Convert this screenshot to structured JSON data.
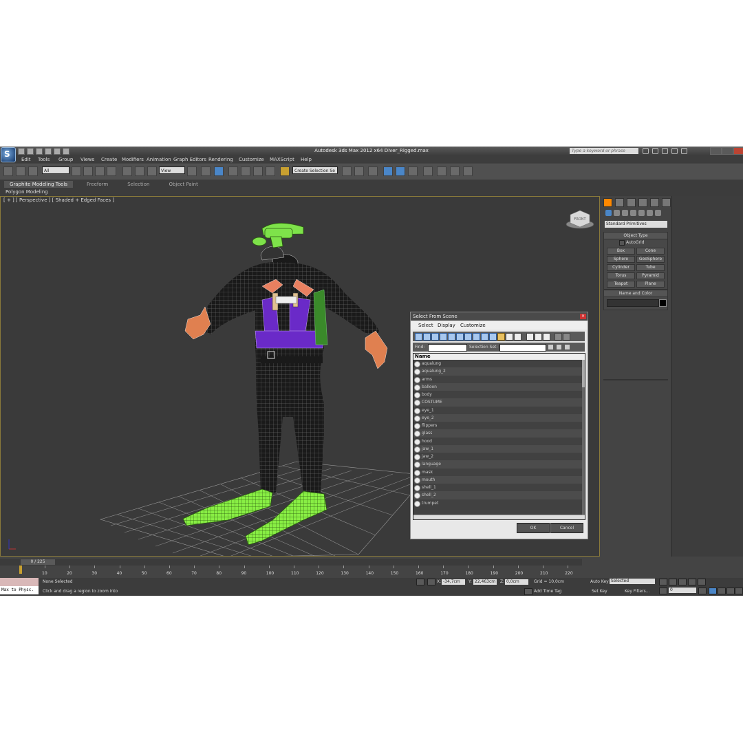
{
  "app": {
    "title": "Autodesk 3ds Max  2012 x64      Diver_Rigged.max",
    "logo_letter": "S",
    "search_placeholder": "Type a keyword or phrase"
  },
  "menu": [
    "Edit",
    "Tools",
    "Group",
    "Views",
    "Create",
    "Modifiers",
    "Animation",
    "Graph Editors",
    "Rendering",
    "Customize",
    "MAXScript",
    "Help"
  ],
  "toolbar": {
    "filter_value": "All",
    "refcoord_value": "View",
    "selection_set_placeholder": "Create Selection Se"
  },
  "ribbon": {
    "tabs": [
      "Graphite Modeling Tools",
      "Freeform",
      "Selection",
      "Object Paint"
    ],
    "subtitle": "Polygon Modeling"
  },
  "viewport": {
    "label": "[ + ] [ Perspective ] [ Shaded + Edged Faces ]",
    "viewcube_label": "FRONT"
  },
  "command_panel": {
    "category_value": "Standard Primitives",
    "object_type_title": "Object Type",
    "autogrid_label": "AutoGrid",
    "primitives": [
      "Box",
      "Cone",
      "Sphere",
      "GeoSphere",
      "Cylinder",
      "Tube",
      "Torus",
      "Pyramid",
      "Teapot",
      "Plane"
    ],
    "name_color_title": "Name and Color"
  },
  "dialog": {
    "title": "Select From Scene",
    "close": "×",
    "menu": [
      "Select",
      "Display",
      "Customize"
    ],
    "find_label": "Find:",
    "selection_set_label": "Selection Set:",
    "column_header": "Name",
    "items": [
      "aqualung",
      "aqualung_2",
      "arms",
      "balloon",
      "body",
      "COSTUME",
      "eye_1",
      "eye_2",
      "flippers",
      "glass",
      "hood",
      "jaw_1",
      "jaw_2",
      "language",
      "mask",
      "mouth",
      "shell_1",
      "shell_2",
      "trumpet"
    ],
    "ok_label": "OK",
    "cancel_label": "Cancel"
  },
  "timeline": {
    "frame_label": "0 / 225",
    "ticks": [
      "10",
      "20",
      "30",
      "40",
      "50",
      "60",
      "70",
      "80",
      "90",
      "100",
      "110",
      "120",
      "130",
      "140",
      "150",
      "160",
      "170",
      "180",
      "190",
      "200",
      "210",
      "220"
    ]
  },
  "status": {
    "maxscript_listener": "Max to Physc.",
    "selection_status": "None Selected",
    "prompt": "Click and drag a region to zoom into",
    "x_label": "X:",
    "x_value": "-34,7cm",
    "y_label": "Y:",
    "y_value": "22,463cm",
    "z_label": "Z:",
    "z_value": "0,0cm",
    "grid": "Grid = 10,0cm",
    "add_time_tag": "Add Time Tag",
    "auto_key": "Auto Key",
    "set_key": "Set Key",
    "key_mode_value": "Selected",
    "key_filters": "Key Filters...",
    "frame_value": "0"
  },
  "colors": {
    "viewport_bg": "#3a3a3a",
    "suit": "#1a1a1a",
    "wire": "#ffffff",
    "harness": "#6a2ac8",
    "fins": "#88ee44",
    "mask": "#7ee24a",
    "skin": "#e08050",
    "active_viewport_border": "#8a7a3a"
  }
}
